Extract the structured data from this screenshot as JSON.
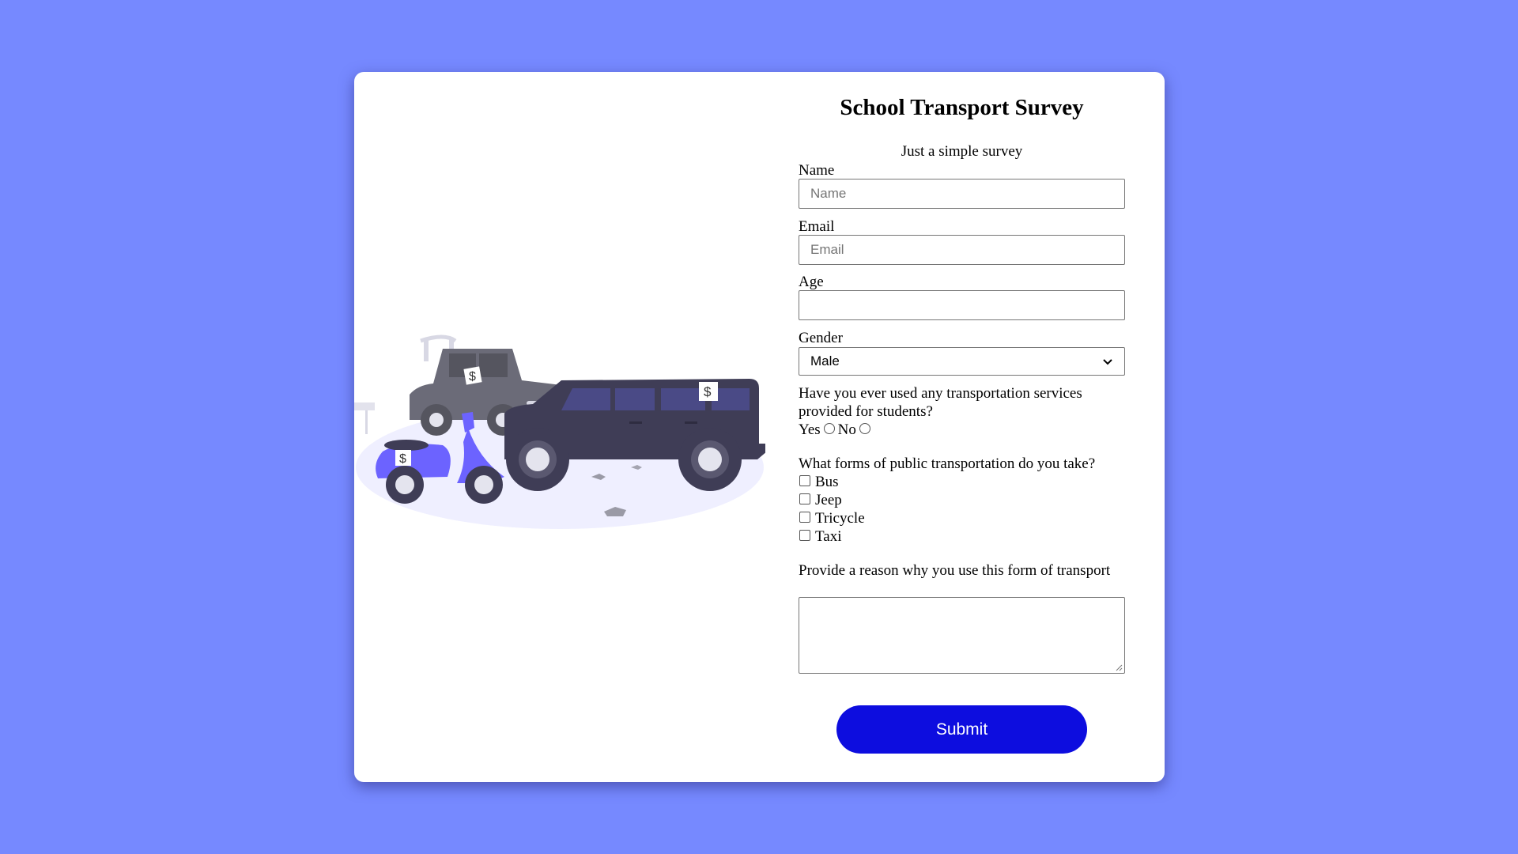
{
  "survey": {
    "title": "School Transport Survey",
    "subtitle": "Just a simple survey",
    "name_label": "Name",
    "name_placeholder": "Name",
    "email_label": "Email",
    "email_placeholder": "Email",
    "age_label": "Age",
    "gender_label": "Gender",
    "gender_selected": "Male",
    "services_question": "Have you ever used any transportation services provided for students?",
    "yes_label": "Yes",
    "no_label": "No",
    "forms_question": "What forms of public transportation do you take?",
    "options": [
      "Bus",
      "Jeep",
      "Tricycle",
      "Taxi"
    ],
    "reason_question": "Provide a reason why you use this form of transport",
    "submit_label": "Submit"
  },
  "colors": {
    "background": "#7689ff",
    "card": "#ffffff",
    "submit": "#0d0ddf"
  },
  "illustration": {
    "sign_text": "$"
  }
}
